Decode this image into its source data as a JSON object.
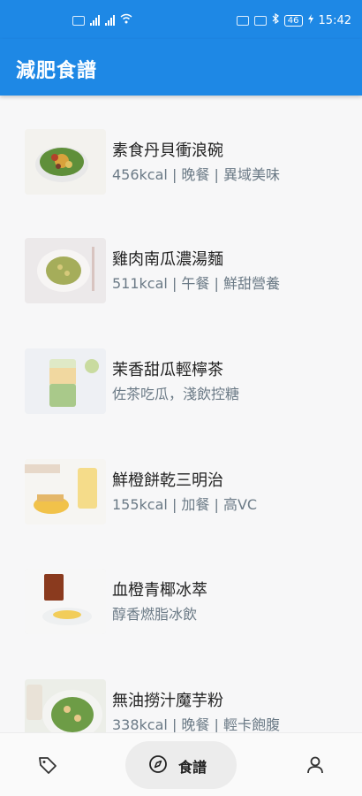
{
  "status_bar": {
    "time": "15:42",
    "battery": "46"
  },
  "app_bar": {
    "title": "減肥食譜"
  },
  "recipes": [
    {
      "name": "素食丹貝衝浪碗",
      "meta": "456kcal | 晚餐 | 異域美味",
      "thumb_icon": "salad-bowl-image"
    },
    {
      "name": "雞肉南瓜濃湯麵",
      "meta": "511kcal | 午餐 | 鮮甜營養",
      "thumb_icon": "noodle-plate-image"
    },
    {
      "name": "茉香甜瓜輕檸茶",
      "meta": "佐茶吃瓜，淺飲控糖",
      "thumb_icon": "lemon-tea-image"
    },
    {
      "name": "鮮橙餅乾三明治",
      "meta": "155kcal | 加餐 | 高VC",
      "thumb_icon": "orange-sandwich-image"
    },
    {
      "name": "血橙青椰冰萃",
      "meta": "醇香燃脂冰飲",
      "thumb_icon": "iced-drink-image"
    },
    {
      "name": "無油撈汁魔芋粉",
      "meta": "338kcal | 晚餐 | 輕卡飽腹",
      "thumb_icon": "konjac-noodle-image"
    }
  ],
  "bottom_nav": {
    "left_icon": "tag-icon",
    "center_label": "食譜",
    "center_icon": "compass-icon",
    "right_icon": "person-icon"
  },
  "colors": {
    "primary": "#1e88e5",
    "meta_text": "#6b7a86"
  }
}
